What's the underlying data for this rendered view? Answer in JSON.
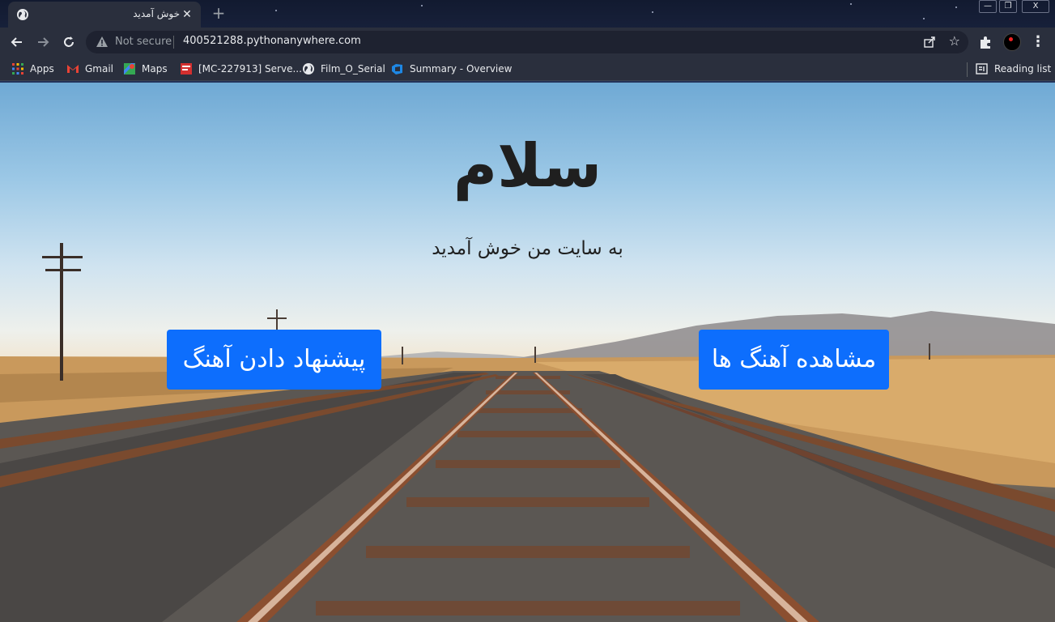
{
  "browser": {
    "tab": {
      "title": "خوش آمدید",
      "close": "✕"
    },
    "new_tab": "+",
    "window_controls": {
      "minimize": "—",
      "restore": "❐",
      "close": "X"
    },
    "address_bar": {
      "security_label": "Not secure",
      "url": "400521288.pythonanywhere.com"
    },
    "bookmarks": [
      {
        "label": "Apps",
        "icon": "apps-grid-icon"
      },
      {
        "label": "Gmail",
        "icon": "gmail-icon"
      },
      {
        "label": "Maps",
        "icon": "maps-icon"
      },
      {
        "label": "[MC-227913] Serve...",
        "icon": "jira-icon"
      },
      {
        "label": "Film_O_Serial",
        "icon": "globe-icon"
      },
      {
        "label": "Summary - Overview",
        "icon": "azure-devops-icon"
      }
    ],
    "reading_list": "Reading list"
  },
  "page": {
    "title": "سلام",
    "subtitle": "به سایت من خوش آمدید",
    "buttons": {
      "suggest_song": "پیشنهاد دادن آهنگ",
      "view_songs": "مشاهده آهنگ ها"
    }
  },
  "colors": {
    "button_bg": "#0d6efd",
    "button_text": "#ffffff",
    "chrome_bg": "#2a2f3d",
    "heading_text": "#1f1f1f"
  }
}
